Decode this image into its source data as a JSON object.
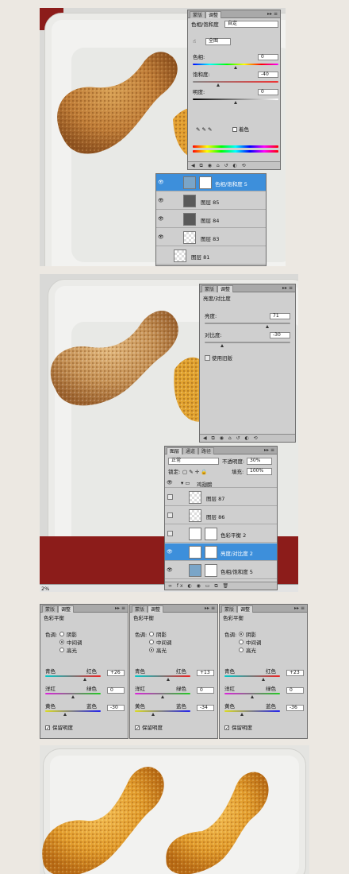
{
  "panel1": {
    "tabs": [
      "蒙版",
      "调整"
    ],
    "title": "色相/饱和度",
    "preset": "自定",
    "channel": "全图",
    "hue_label": "色相:",
    "hue_value": "0",
    "sat_label": "饱和度:",
    "sat_value": "-40",
    "light_label": "明度:",
    "light_value": "0",
    "colorize_label": "着色",
    "layers": [
      "色相/饱和度 5",
      "图层 85",
      "图层 84",
      "图层 83",
      "图层 81"
    ]
  },
  "panel2": {
    "tabs": [
      "蒙版",
      "调整"
    ],
    "title": "亮度/对比度",
    "bright_label": "亮度:",
    "bright_value": "71",
    "contrast_label": "对比度:",
    "contrast_value": "-30",
    "legacy_label": "使用旧版",
    "layers_tabs": [
      "图层",
      "通道",
      "路径"
    ],
    "blend_mode": "正常",
    "opacity_label": "不透明度:",
    "opacity_value": "30%",
    "lock_label": "锁定:",
    "fill_label": "填充:",
    "fill_value": "100%",
    "group_name": "鸡翅膀",
    "layers": [
      "图层 87",
      "图层 86",
      "色彩平衡 2",
      "亮度/对比度 2",
      "色相/饱和度 5"
    ],
    "zoom": "2%"
  },
  "panels3": [
    {
      "tabs": [
        "蒙版",
        "调整"
      ],
      "title": "色彩平衡",
      "tone_label": "色调:",
      "tones": [
        "阴影",
        "中间调",
        "高光"
      ],
      "tone_selected": 1,
      "cyan": "青色",
      "red": "红色",
      "v1": "+26",
      "magenta": "洋红",
      "green": "绿色",
      "v2": "0",
      "yellow": "黄色",
      "blue": "蓝色",
      "v3": "-30",
      "preserve": "保留明度",
      "k1": 0.72,
      "k2": 0.5,
      "k3": 0.35
    },
    {
      "tabs": [
        "蒙版",
        "调整"
      ],
      "title": "色彩平衡",
      "tone_label": "色调:",
      "tones": [
        "阴影",
        "中间调",
        "高光"
      ],
      "tone_selected": 2,
      "cyan": "青色",
      "red": "红色",
      "v1": "+13",
      "magenta": "洋红",
      "green": "绿色",
      "v2": "0",
      "yellow": "黄色",
      "blue": "蓝色",
      "v3": "-34",
      "preserve": "保留明度",
      "k1": 0.6,
      "k2": 0.5,
      "k3": 0.33
    },
    {
      "tabs": [
        "蒙版",
        "调整"
      ],
      "title": "色彩平衡",
      "tone_label": "色调:",
      "tones": [
        "阴影",
        "中间调",
        "高光"
      ],
      "tone_selected": 0,
      "cyan": "青色",
      "red": "红色",
      "v1": "+23",
      "magenta": "洋红",
      "green": "绿色",
      "v2": "0",
      "yellow": "黄色",
      "blue": "蓝色",
      "v3": "-36",
      "preserve": "保留明度",
      "k1": 0.7,
      "k2": 0.5,
      "k3": 0.32
    }
  ],
  "colors": {
    "selection": "#3d8fdb",
    "tray_red": "#8c1c1a",
    "fried": "#c68638"
  }
}
